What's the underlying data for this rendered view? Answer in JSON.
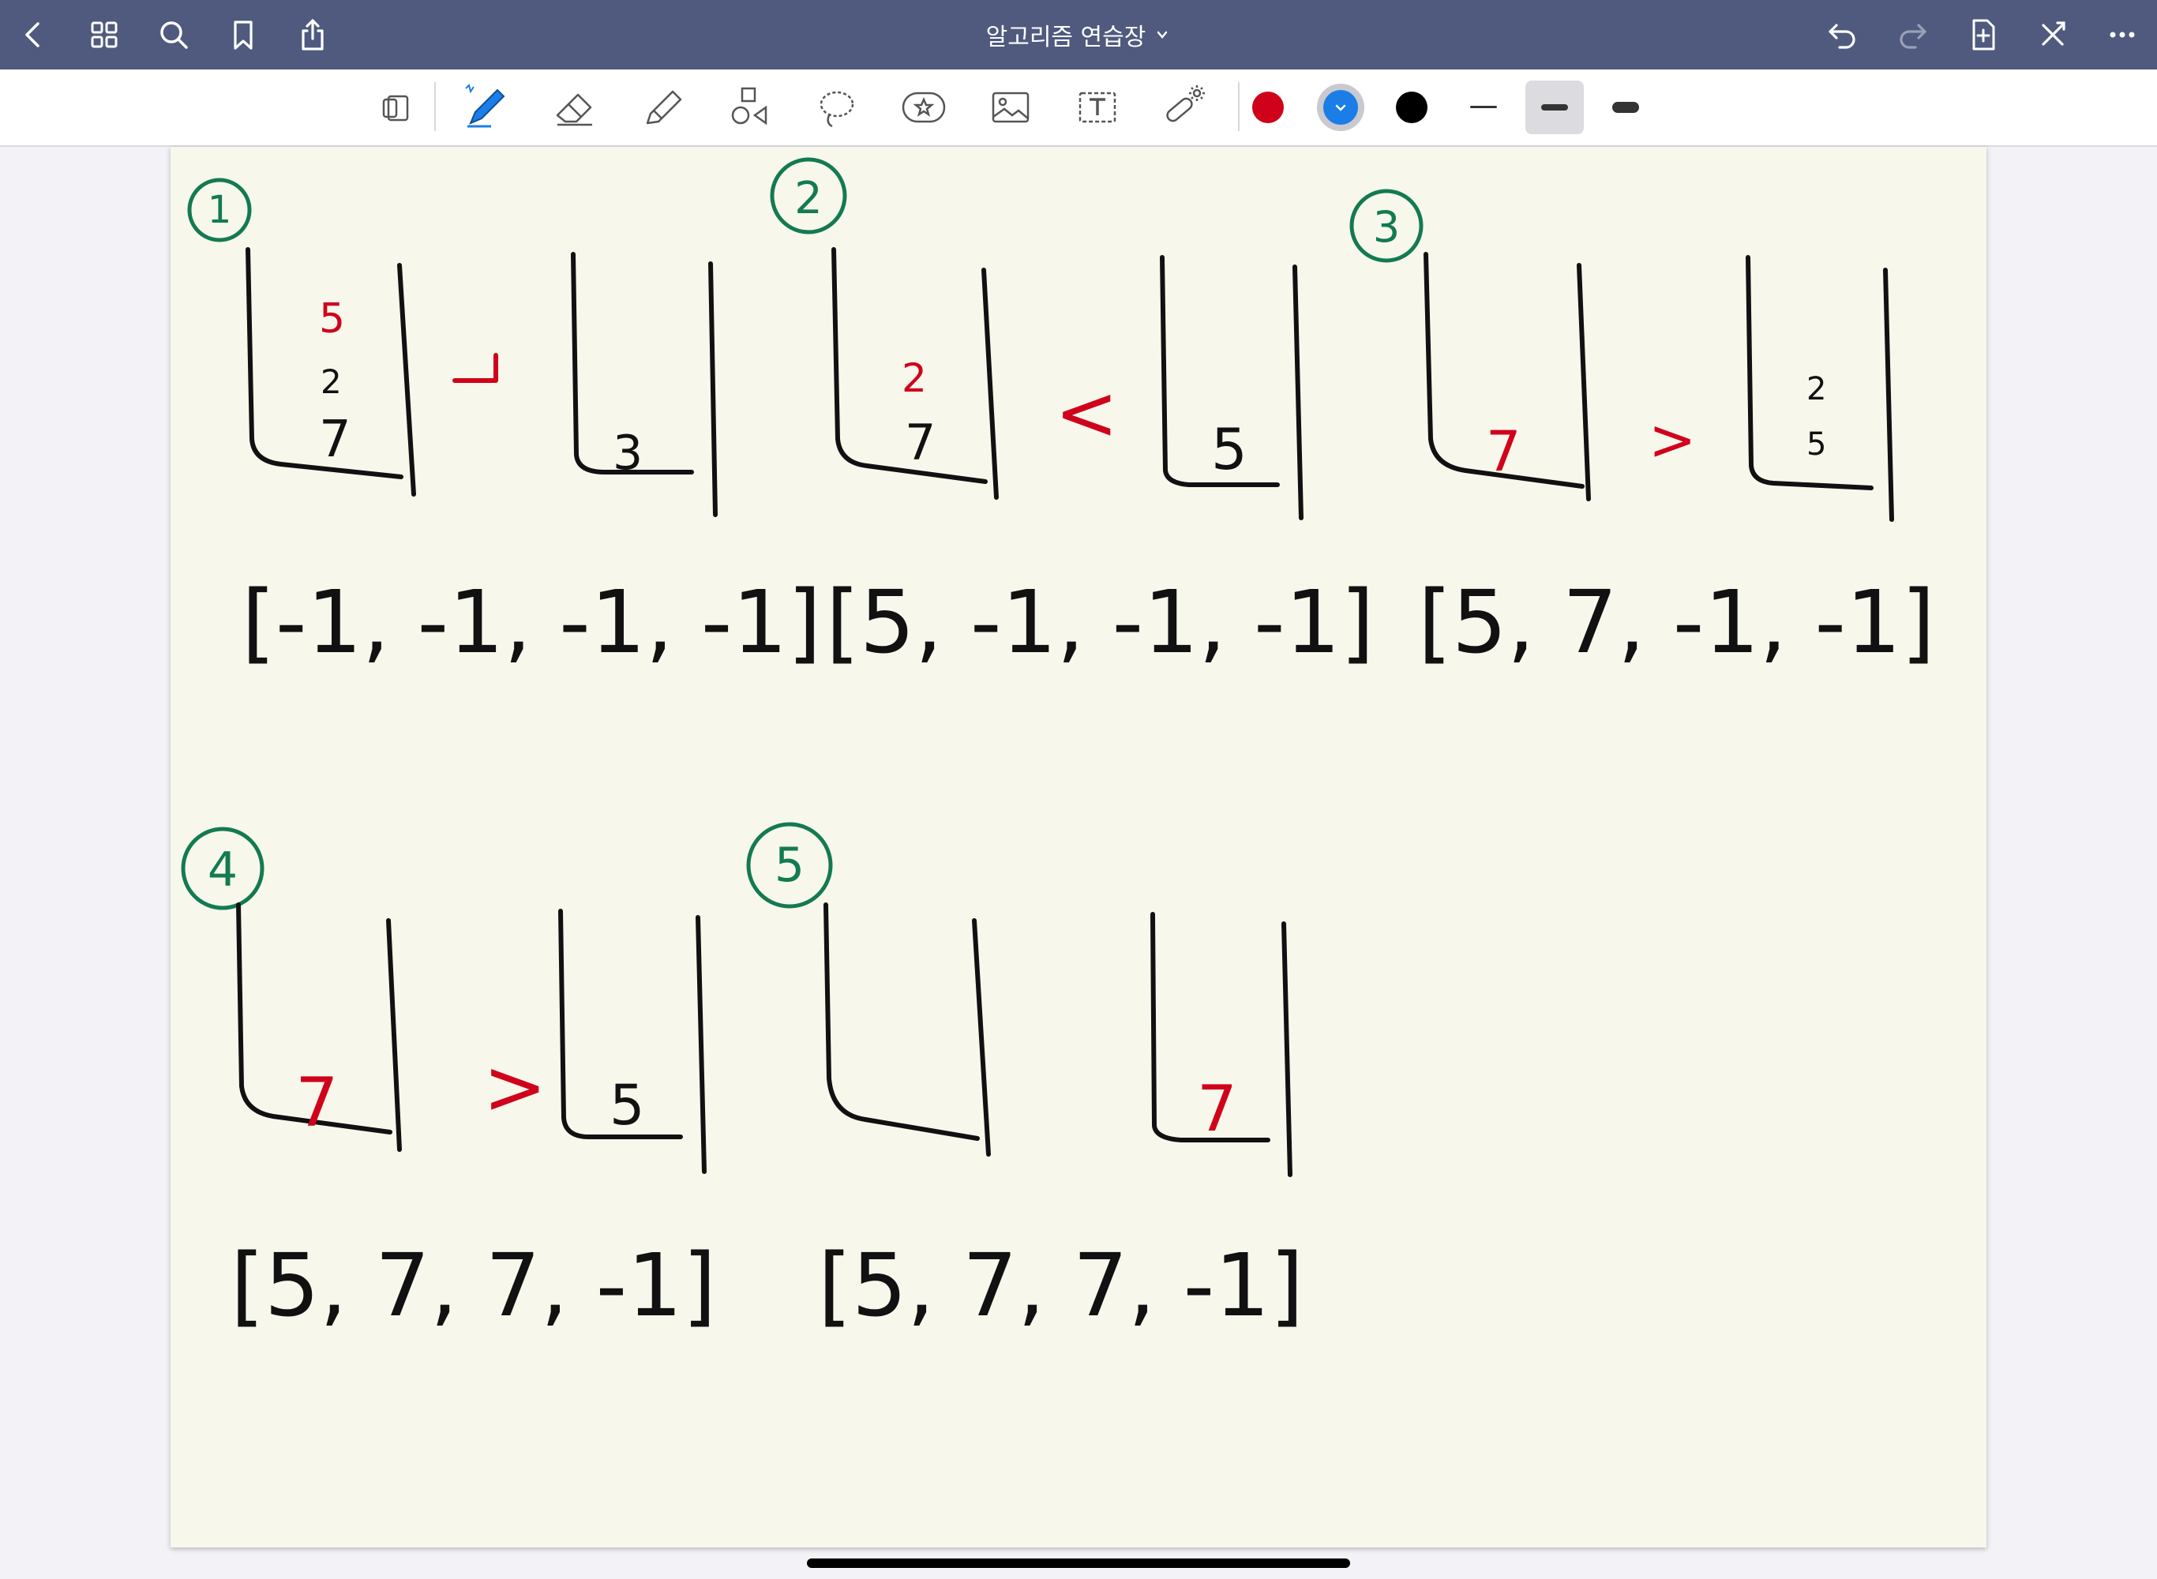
{
  "app": {
    "document_title": "알고리즘 연습장",
    "colors": {
      "topbar": "#4f5a7e",
      "paper": "#f7f7ec",
      "ink_black": "#111111",
      "ink_red": "#d0021b",
      "ink_blue": "#1a7ee6",
      "ink_green": "#137a52"
    }
  },
  "topbar": {
    "left_icons": [
      "back-icon",
      "grid-icon",
      "search-icon",
      "bookmark-icon",
      "share-icon"
    ],
    "right_icons": [
      "undo-icon",
      "redo-icon",
      "add-page-icon",
      "close-edit-icon",
      "more-icon"
    ]
  },
  "toolbar": {
    "tools": [
      "read-mode-icon",
      "pen-icon",
      "eraser-icon",
      "highlighter-icon",
      "shapes-icon",
      "lasso-icon",
      "sticker-icon",
      "image-icon",
      "text-icon",
      "laser-pointer-icon"
    ],
    "selected_tool": "pen",
    "pen_colors": [
      "#d0021b",
      "#1a7ee6",
      "#000000"
    ],
    "selected_color": "#1a7ee6",
    "stroke_widths": [
      "thin",
      "medium",
      "thick"
    ],
    "selected_width": "medium"
  },
  "notes": {
    "step_labels": [
      "1",
      "2",
      "3",
      "4",
      "5"
    ],
    "arrays": [
      {
        "step": "1",
        "text": "[-1, -1, -1, -1]"
      },
      {
        "step": "2",
        "text": "[5, -1, -1, -1]"
      },
      {
        "step": "3",
        "text": "[5, 7, -1, -1]"
      },
      {
        "step": "4",
        "text": "[5, 7, 7, -1]"
      },
      {
        "step": "5",
        "text": "[5, 7, 7, -1]"
      }
    ],
    "stack_values": {
      "step1_left": [
        "5",
        "2",
        "7"
      ],
      "step1_right": [
        "3"
      ],
      "step2_left": [
        "2",
        "7"
      ],
      "step2_right": [
        "5"
      ],
      "step3_left": [
        "7"
      ],
      "step3_right": [
        "2",
        "5"
      ],
      "step4_left": [
        "7"
      ],
      "step4_right": [
        "5"
      ],
      "step5_left": [],
      "step5_right": [
        "7"
      ]
    },
    "comparisons": [
      "<",
      ">",
      ">"
    ]
  }
}
